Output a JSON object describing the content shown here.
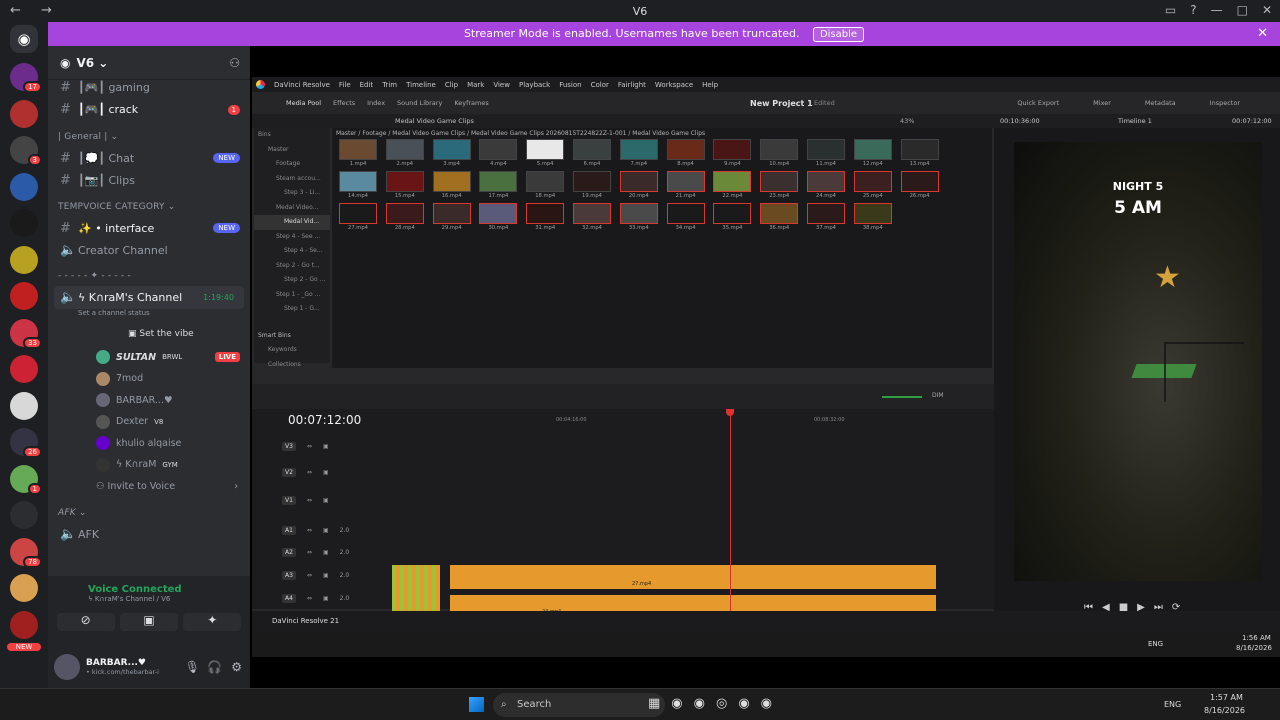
{
  "window": {
    "title": "V6",
    "nav": "← →"
  },
  "banner": {
    "text": "Streamer Mode is enabled. Usernames have been truncated.",
    "disable": "Disable"
  },
  "server": {
    "name": "V6"
  },
  "servers": [
    {
      "color": "#6b2c8c",
      "badge": "17"
    },
    {
      "color": "#b03030",
      "badge": ""
    },
    {
      "color": "#444",
      "badge": "3"
    },
    {
      "color": "#2a5aa8",
      "badge": ""
    },
    {
      "color": "#1a1a1a",
      "badge": ""
    },
    {
      "color": "#b8a020",
      "badge": ""
    },
    {
      "color": "#c02020",
      "badge": ""
    },
    {
      "color": "#cc3344",
      "badge": "33"
    },
    {
      "color": "#cc2233",
      "badge": ""
    },
    {
      "color": "#d8d8d8",
      "badge": ""
    },
    {
      "color": "#334",
      "badge": "26"
    },
    {
      "color": "#6a5",
      "badge": "1"
    },
    {
      "color": "#2b2d31",
      "badge": ""
    },
    {
      "color": "#c44",
      "badge": "78"
    },
    {
      "color": "#d8a050",
      "badge": ""
    },
    {
      "color": "#a02020",
      "badge": ""
    }
  ],
  "new_label": "NEW",
  "channels": {
    "gaming": "┃🎮┃ gaming",
    "crack": "┃🎮┃ crack",
    "crack_badge": "1",
    "general_cat": "| General |",
    "chat": "┃💭┃ Chat",
    "clips": "┃📷┃ Clips",
    "tempvoice_cat": "TEMPVOICE CATEGORY",
    "interface": "✨ • interface",
    "creator": "Creator Channel",
    "divider": "- - - - - ✦ - - - - -",
    "karam": "ϟ K∩raM's Channel",
    "karam_time": "1:19:40",
    "status": "Set a channel status",
    "vibe": "Set the vibe",
    "invite": "Invite to Voice",
    "afk_cat": "AFK",
    "afk": "AFK"
  },
  "voice_users": [
    {
      "name": "SULTAN",
      "tag": "BRWL",
      "live": "LIVE",
      "color": "#4a8"
    },
    {
      "name": "7mod",
      "tag": "",
      "live": "",
      "color": "#a86"
    },
    {
      "name": "BARBAR...♥",
      "tag": "",
      "live": "",
      "color": "#667"
    },
    {
      "name": "Dexter",
      "tag": "V8",
      "live": "",
      "color": "#555"
    },
    {
      "name": "khulio alqaise",
      "tag": "",
      "live": "",
      "color": "#60c"
    },
    {
      "name": "ϟ K∩raM",
      "tag": "GYM",
      "live": "",
      "color": "#333"
    }
  ],
  "voice_panel": {
    "status": "Voice Connected",
    "channel": "ϟ K∩raM's Channel / V6"
  },
  "user": {
    "name": "BARBAR...♥",
    "sub": "• kick.com/thebarbar-i"
  },
  "resolve": {
    "menu": [
      "DaVinci Resolve",
      "File",
      "Edit",
      "Trim",
      "Timeline",
      "Clip",
      "Mark",
      "View",
      "Playback",
      "Fusion",
      "Color",
      "Fairlight",
      "Workspace",
      "Help"
    ],
    "tools": [
      "Media Pool",
      "Effects",
      "Index",
      "Sound Library",
      "Keyframes"
    ],
    "project": "New Project 1",
    "edited": "Edited",
    "right_tools": [
      "Quick Export",
      "Mixer",
      "Metadata",
      "Inspector"
    ],
    "bin_title": "Medal Video Game Clips",
    "zoom": "43%",
    "src_tc": "00:10:36:00",
    "timeline_name": "Timeline 1",
    "rec_tc": "00:07:12:00",
    "breadcrumb": "Master / Footage / Medal Video Game Clips / Medal Video Game Clips 20260815T224822Z-1-001 / Medal Video Game Clips",
    "bins": [
      "Bins",
      "Master",
      "Footage",
      "Steam accou...",
      "Step 3 - Li...",
      "Medal Video...",
      "Medal Vid...",
      "Step 4 - See ...",
      "Step 4 - Se...",
      "Step 2 - Go t...",
      "Step 2 - Go ...",
      "Step 1 - _Go ...",
      "Step 1 - G...",
      "Smart Bins",
      "Keywords",
      "Collections"
    ],
    "clips": [
      "1.mp4",
      "2.mp4",
      "3.mp4",
      "4.mp4",
      "5.mp4",
      "6.mp4",
      "7.mp4",
      "8.mp4",
      "9.mp4",
      "10.mp4",
      "11.mp4",
      "12.mp4",
      "13.mp4",
      "14.mp4",
      "15.mp4",
      "16.mp4",
      "17.mp4",
      "18.mp4",
      "19.mp4",
      "20.mp4",
      "21.mp4",
      "22.mp4",
      "23.mp4",
      "24.mp4",
      "25.mp4",
      "26.mp4",
      "27.mp4",
      "28.mp4",
      "29.mp4",
      "30.mp4",
      "31.mp4",
      "32.mp4",
      "33.mp4",
      "34.mp4",
      "35.mp4",
      "36.mp4",
      "37.mp4",
      "38.mp4"
    ],
    "overlay1": "NIGHT 5",
    "overlay2": "5 AM",
    "timecode": "00:07:12:00",
    "ruler": [
      "00:04:16:00",
      "00:08:32:00"
    ],
    "tracks": [
      "V3",
      "V2",
      "V1",
      "A1",
      "A2",
      "A3",
      "A4"
    ],
    "track_val": "2.0",
    "footer": "DaVinci Resolve 21",
    "dim": "DIM",
    "clip_labels": [
      "21...",
      "27.mp4",
      "24.mp4",
      "27.mp4"
    ]
  },
  "win_taskbar": {
    "search": "Search",
    "tray": "ENG",
    "time": "1:57 AM",
    "date": "8/16/2026",
    "inner_time": "1:56 AM",
    "inner_date": "8/16/2026"
  }
}
